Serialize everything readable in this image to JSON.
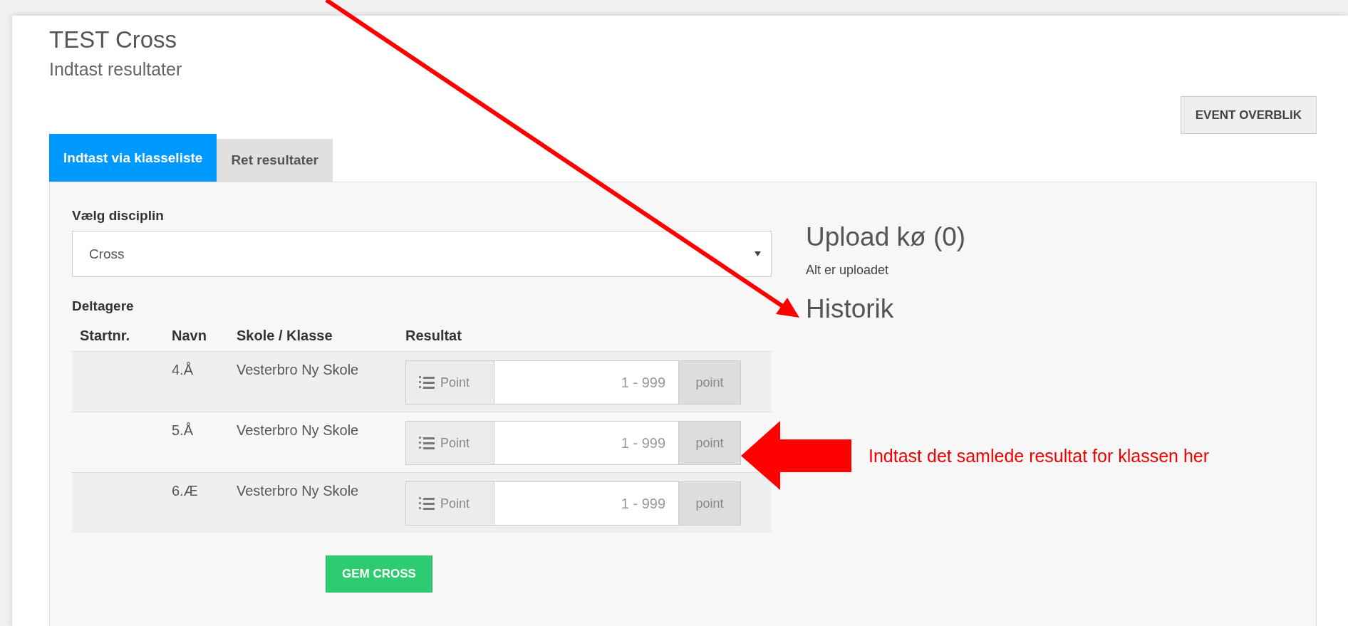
{
  "page": {
    "title": "TEST Cross",
    "subtitle": "Indtast resultater"
  },
  "header_button": "EVENT OVERBLIK",
  "tabs": [
    {
      "label": "Indtast via klasseliste",
      "selected": true
    },
    {
      "label": "Ret resultater",
      "selected": false
    }
  ],
  "discipline": {
    "label": "Vælg disciplin",
    "value": "Cross"
  },
  "participants": {
    "label": "Deltagere",
    "columns": [
      "Startnr.",
      "Navn",
      "Skole / Klasse",
      "Resultat"
    ],
    "rows": [
      {
        "name": "4.Å",
        "school": "Vesterbro Ny Skole",
        "addon": "Point",
        "placeholder": "1 - 999",
        "unit": "point"
      },
      {
        "name": "5.Å",
        "school": "Vesterbro Ny Skole",
        "addon": "Point",
        "placeholder": "1 - 999",
        "unit": "point"
      },
      {
        "name": "6.Æ",
        "school": "Vesterbro Ny Skole",
        "addon": "Point",
        "placeholder": "1 - 999",
        "unit": "point"
      }
    ]
  },
  "save_button": "GEM CROSS",
  "upload": {
    "title": "Upload kø (0)",
    "status": "Alt er uploadet"
  },
  "history": {
    "title": "Historik"
  },
  "annotation": {
    "text": "Indtast det samlede resultat for klassen her"
  }
}
